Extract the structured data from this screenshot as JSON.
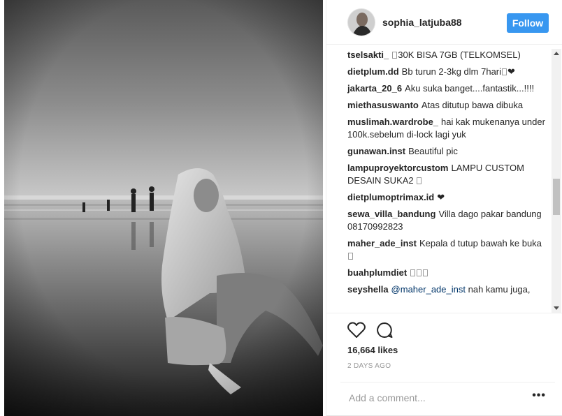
{
  "header": {
    "username": "sophia_latjuba88",
    "follow_label": "Follow",
    "accent_color": "#3897f0"
  },
  "comments": [
    {
      "user": "tselsakti_",
      "text": "30K BISA 7GB (TELKOMSEL)"
    },
    {
      "user": "dietplum.dd",
      "text": "Bb turun 2-3kg dlm 7hari",
      "suffix": "❤"
    },
    {
      "user": "jakarta_20_6",
      "text": "Aku suka banget....fantastik...!!!!"
    },
    {
      "user": "miethasuswanto",
      "text": "Atas ditutup bawa dibuka"
    },
    {
      "user": "muslimah.wardrobe_",
      "text": "hai kak mukenanya under 100k.sebelum di-lock lagi yuk"
    },
    {
      "user": "gunawan.inst",
      "text": "Beautiful pic"
    },
    {
      "user": "lampuproyektorcustom",
      "text": "LAMPU CUSTOM DESAIN SUKA2"
    },
    {
      "user": "dietplumoptrimax.id",
      "text": "❤"
    },
    {
      "user": "sewa_villa_bandung",
      "text": "Villa dago pakar bandung 08170992823"
    },
    {
      "user": "maher_ade_inst",
      "text": "Kepala d tutup bawah ke buka"
    },
    {
      "user": "buahplumdiet",
      "text": ""
    },
    {
      "user": "seyshella",
      "mention": "@maher_ade_inst",
      "text": "nah kamu juga,"
    }
  ],
  "actions": {
    "like_icon": "heart-icon",
    "comment_icon": "comment-icon",
    "likes": "16,664 likes",
    "time_ago": "2 DAYS AGO"
  },
  "add_comment": {
    "placeholder": "Add a comment...",
    "more_label": "•••"
  }
}
